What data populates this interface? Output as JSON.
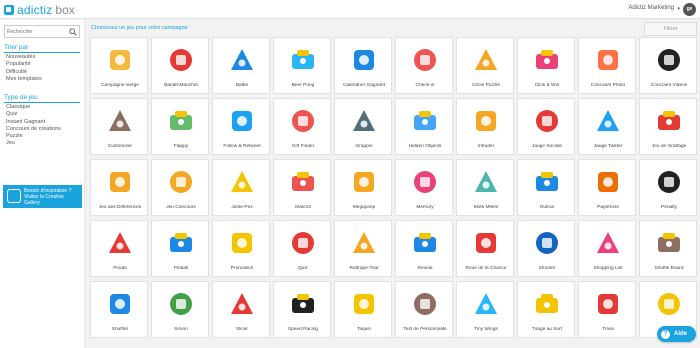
{
  "brand": {
    "name": "adictiz",
    "suffix": "box",
    "accent": "#1aa3dd"
  },
  "account": {
    "name": "Adictiz Marketing",
    "avatar": "ge"
  },
  "search": {
    "placeholder": "Rechercher"
  },
  "sort": {
    "heading": "Trier par",
    "items": [
      "Nouveautés",
      "Popularité",
      "Difficulté",
      "Mes templates"
    ]
  },
  "gametype": {
    "heading": "Type de jeu",
    "items": [
      "Classique",
      "Quiz",
      "Instant Gagnant",
      "Concours de créations",
      "Puzzle",
      "Jeu"
    ]
  },
  "promo": {
    "text": "Besoin d'inspiration ? Visitez la Creative Gallery"
  },
  "main": {
    "title": "Choisissez un jeu pour votre campagne",
    "filter_label": "Filtrer"
  },
  "games": [
    {
      "label": "Campagne vierge",
      "icon": "blank-campaign-icon",
      "color": "#f5b942"
    },
    {
      "label": "Bandit-Manchot",
      "icon": "slot-machine-icon",
      "color": "#e53935"
    },
    {
      "label": "Battle",
      "icon": "battle-icon",
      "color": "#1e88e5"
    },
    {
      "label": "Beer Pong",
      "icon": "beer-pong-icon",
      "color": "#29b6f6"
    },
    {
      "label": "Calendrier Gagnant",
      "icon": "calendar-icon",
      "color": "#1e88e5"
    },
    {
      "label": "Check-in",
      "icon": "map-pin-icon",
      "color": "#ef5350"
    },
    {
      "label": "Circle Puzzle",
      "icon": "circle-puzzle-icon",
      "color": "#f5a623"
    },
    {
      "label": "Click & Win",
      "icon": "gift-icon",
      "color": "#ec407a"
    },
    {
      "label": "Concours Photo",
      "icon": "camera-icon",
      "color": "#ff7043"
    },
    {
      "label": "Concours Vidéos",
      "icon": "clapperboard-icon",
      "color": "#212121"
    },
    {
      "label": "Customizer",
      "icon": "paint-roller-icon",
      "color": "#8d6e63"
    },
    {
      "label": "Flappy",
      "icon": "pipes-icon",
      "color": "#66bb6a"
    },
    {
      "label": "Follow & Retweet",
      "icon": "twitter-icon",
      "color": "#1da1f2"
    },
    {
      "label": "Gift Finder",
      "icon": "gift-finder-icon",
      "color": "#ef5350"
    },
    {
      "label": "Grappin",
      "icon": "claw-icon",
      "color": "#546e7a"
    },
    {
      "label": "Hidden Objects",
      "icon": "hidden-objects-icon",
      "color": "#42a5f5"
    },
    {
      "label": "Intruder",
      "icon": "intruder-icon",
      "color": "#f5a623"
    },
    {
      "label": "Jauge Sociale",
      "icon": "thermometer-icon",
      "color": "#e53935"
    },
    {
      "label": "Jauge Twitter",
      "icon": "thermometer-twitter-icon",
      "color": "#1da1f2"
    },
    {
      "label": "Jeu de Grattage",
      "icon": "scratch-ticket-icon",
      "color": "#e53935"
    },
    {
      "label": "Jeu des Différences",
      "icon": "stars-icon",
      "color": "#f5a623"
    },
    {
      "label": "Jeu Concours",
      "icon": "medal-icon",
      "color": "#f5a623"
    },
    {
      "label": "Juste-Prix",
      "icon": "question-coin-icon",
      "color": "#f5c400"
    },
    {
      "label": "Match3",
      "icon": "triangles-icon",
      "color": "#ef5350"
    },
    {
      "label": "Megajump",
      "icon": "rocket-icon",
      "color": "#f5a623"
    },
    {
      "label": "Memory",
      "icon": "memory-cards-icon",
      "color": "#ec407a"
    },
    {
      "label": "Mots Mêlés",
      "icon": "word-search-icon",
      "color": "#4db6ac"
    },
    {
      "label": "Outrun",
      "icon": "car-icon",
      "color": "#1e88e5"
    },
    {
      "label": "Papertoss",
      "icon": "basketball-icon",
      "color": "#ef6c00"
    },
    {
      "label": "Penalty",
      "icon": "soccer-ball-icon",
      "color": "#212121"
    },
    {
      "label": "Pinata",
      "icon": "pinata-icon",
      "color": "#e53935"
    },
    {
      "label": "Pinball",
      "icon": "pinball-icon",
      "color": "#1e88e5"
    },
    {
      "label": "Pronostics",
      "icon": "trophy-icon",
      "color": "#f5c400"
    },
    {
      "label": "Quiz",
      "icon": "quiz-icon",
      "color": "#e53935"
    },
    {
      "label": "Rattrape-Tout",
      "icon": "basket-icon",
      "color": "#f5a623"
    },
    {
      "label": "Reveal",
      "icon": "reveal-icon",
      "color": "#1e88e5"
    },
    {
      "label": "Roue de la Chance",
      "icon": "wheel-icon",
      "color": "#e53935"
    },
    {
      "label": "Shooter",
      "icon": "target-icon",
      "color": "#1565c0"
    },
    {
      "label": "Shopping List",
      "icon": "shopping-bag-icon",
      "color": "#ec407a"
    },
    {
      "label": "Shuffle Board",
      "icon": "chest-icon",
      "color": "#8d6e63"
    },
    {
      "label": "Shuffler",
      "icon": "shuffler-icon",
      "color": "#1e88e5"
    },
    {
      "label": "Simon",
      "icon": "simon-icon",
      "color": "#43a047"
    },
    {
      "label": "Slicer",
      "icon": "slicer-icon",
      "color": "#e53935"
    },
    {
      "label": "Speed Racing",
      "icon": "steering-wheel-icon",
      "color": "#212121"
    },
    {
      "label": "Taquin",
      "icon": "sliding-puzzle-icon",
      "color": "#f5c400"
    },
    {
      "label": "Test de Personnalité",
      "icon": "personality-icon",
      "color": "#8d6e63"
    },
    {
      "label": "Tiny Wings",
      "icon": "tiny-wings-icon",
      "color": "#29b6f6"
    },
    {
      "label": "Tirage au Sort",
      "icon": "lottery-ball-icon",
      "color": "#f5c400"
    },
    {
      "label": "Trivia",
      "icon": "trivia-icon",
      "color": "#e53935"
    },
    {
      "label": "",
      "icon": "ballot-box-icon",
      "color": "#f5c400"
    }
  ],
  "help": {
    "label": "Aide"
  }
}
